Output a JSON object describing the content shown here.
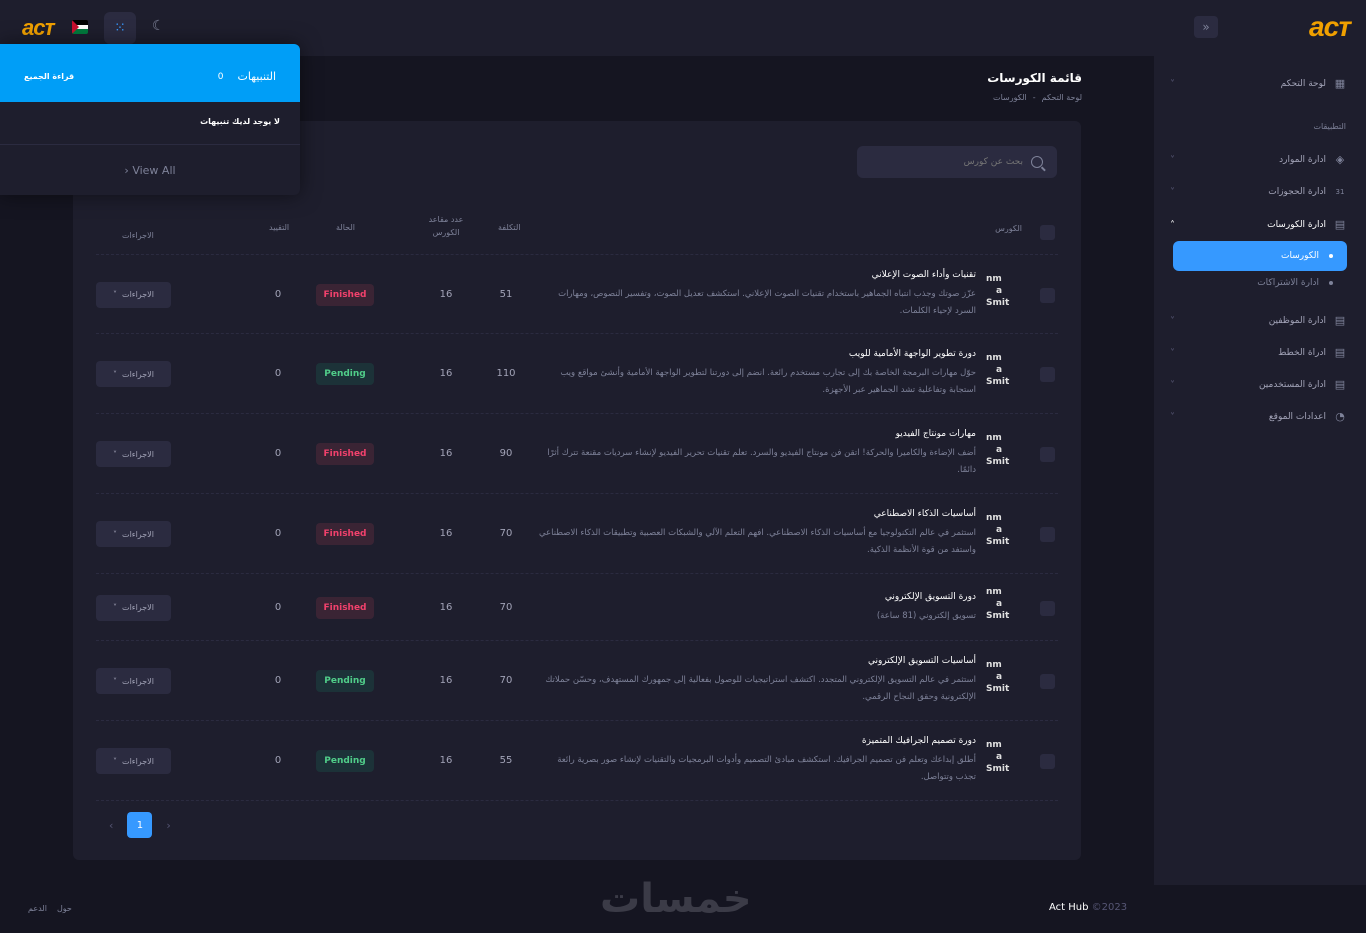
{
  "header": {
    "logo": "acᴛ",
    "bell_icon": "⁙",
    "moon_icon": "☾"
  },
  "sidebar": {
    "logo": "acᴛ",
    "toggle_icon": "»",
    "section_label": "التطبيقات",
    "items": [
      {
        "label": "لوحة التحكم",
        "icon": "▦"
      },
      {
        "label": "ادارة الموارد",
        "icon": "◈"
      },
      {
        "label": "ادارة الحجوزات",
        "icon": "31"
      },
      {
        "label": "ادارة الكورسات",
        "icon": "▤"
      },
      {
        "label": "ادارة الموظفين",
        "icon": "▤"
      },
      {
        "label": "ادراة الخطط",
        "icon": "▤"
      },
      {
        "label": "ادارة المستخدمين",
        "icon": "▤"
      },
      {
        "label": "اعدادات الموقع",
        "icon": "◔"
      }
    ],
    "sub_active": "الكورسات",
    "sub_other": "ادارة الاشتراكات",
    "chevron_down": "˅",
    "chevron_up": "˄"
  },
  "toolbar": {
    "title": "قائمة الكورسات",
    "crumb_home": "لوحة التحكم",
    "crumb_sep": "-",
    "crumb_current": "الكورسات"
  },
  "search": {
    "placeholder": "بحث عن كورس"
  },
  "table": {
    "headers": {
      "course": "الكورس",
      "cost": "التكلفة",
      "seats_line1": "عدد مقاعد",
      "seats_line2": "الكورس",
      "status": "الحالة",
      "enroll": "التقييد",
      "actions": "الاجراءات"
    },
    "thumb_text": [
      "nm",
      "a",
      "Smit"
    ],
    "actions_label": "الاجراءات",
    "rows": [
      {
        "title": "تقنيات وأداء الصوت الإعلاني",
        "desc": "عزّز صوتك وجذب انتباه الجماهير باستخدام تقنيات الصوت الإعلاني. استكشف تعديل الصوت، وتفسير النصوص، ومهارات السرد لإحياء الكلمات.",
        "cost": "51",
        "seats": "16",
        "status": "Finished",
        "enroll": "0"
      },
      {
        "title": "دورة تطوير الواجهة الأمامية للويب",
        "desc": "حوّل مهارات البرمجة الخاصة بك إلى تجارب مستخدم رائعة. انضم إلى دورتنا لتطوير الواجهة الأمامية وأنشئ مواقع ويب استجابة وتفاعلية تشد الجماهير عبر الأجهزة.",
        "cost": "110",
        "seats": "16",
        "status": "Pending",
        "enroll": "0"
      },
      {
        "title": "مهارات مونتاج الفيديو",
        "desc": "أضف الإضاءة والكاميرا والحركة! اتقن فن مونتاج الفيديو والسرد. تعلم تقنيات تحرير الفيديو لإنشاء سرديات مقنعة تترك أثرًا دائمًا.",
        "cost": "90",
        "seats": "16",
        "status": "Finished",
        "enroll": "0"
      },
      {
        "title": "أساسيات الذكاء الاصطناعي",
        "desc": "استثمر في عالم التكنولوجيا مع أساسيات الذكاء الاصطناعي. افهم التعلم الآلي والشبكات العصبية وتطبيقات الذكاء الاصطناعي واستفد من قوة الأنظمة الذكية.",
        "cost": "70",
        "seats": "16",
        "status": "Finished",
        "enroll": "0"
      },
      {
        "title": "دورة التسويق الإلكتروني",
        "desc": "تسويق إلكتروني (81 ساعة)",
        "cost": "70",
        "seats": "16",
        "status": "Finished",
        "enroll": "0"
      },
      {
        "title": "أساسيات التسويق الإلكتروني",
        "desc": "استثمر في عالم التسويق الإلكتروني المتجدد. اكتشف استراتيجيات للوصول بفعالية إلى جمهورك المستهدف، وحسّن حملاتك الإلكترونية وحقق النجاح الرقمي.",
        "cost": "70",
        "seats": "16",
        "status": "Pending",
        "enroll": "0"
      },
      {
        "title": "دورة تصميم الجرافيك المتميزة",
        "desc": "أطلق إبداعك وتعلم فن تصميم الجرافيك. استكشف مبادئ التصميم وأدوات البرمجيات والتقنيات لإنشاء صور بصرية رائعة تجذب وتتواصل.",
        "cost": "55",
        "seats": "16",
        "status": "Pending",
        "enroll": "0"
      }
    ]
  },
  "pagination": {
    "prev": "‹",
    "current": "1",
    "next": "›"
  },
  "notifications": {
    "title": "التنبيهات",
    "count": "0",
    "read_all": "قراءة الجميع",
    "empty": "لا يوجد لديك تنبيهات",
    "view_all": "› View All"
  },
  "footer": {
    "link_about": "حول",
    "link_support": "الدعم",
    "copyright_year": "©2023",
    "brand": "Act Hub",
    "watermark": "خمسات"
  },
  "colors": {
    "primary": "#3699ff",
    "notif_header": "#009ef7",
    "danger": "#f1416c",
    "success": "#50cd89",
    "logo": "#f0a000"
  }
}
